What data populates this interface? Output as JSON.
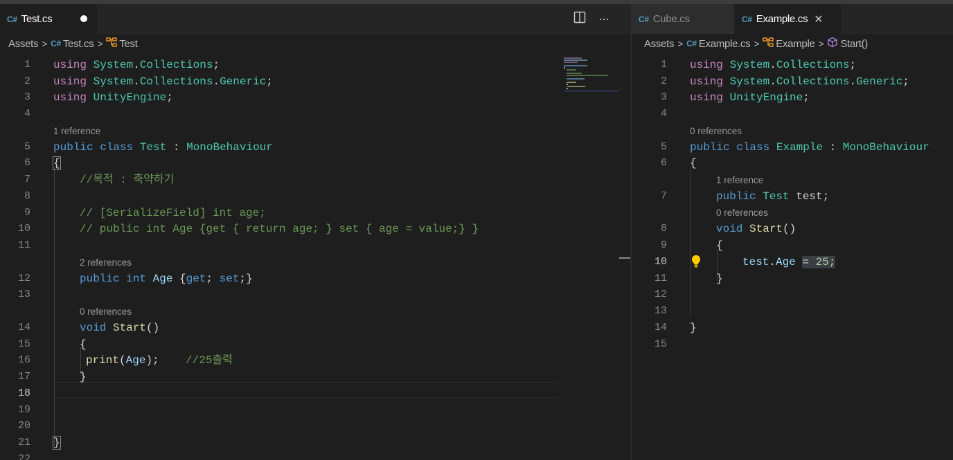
{
  "left": {
    "tabs": [
      {
        "label": "Test.cs",
        "active": true,
        "dirty": true
      }
    ],
    "actions": {
      "split_icon": "split-editor-icon",
      "more_label": "···"
    },
    "breadcrumb": {
      "folder": "Assets",
      "file": "Test.cs",
      "symbol": "Test"
    },
    "lines": [
      "1",
      "2",
      "3",
      "4",
      "5",
      "6",
      "7",
      "8",
      "9",
      "10",
      "11",
      "12",
      "13",
      "14",
      "15",
      "16",
      "17",
      "18",
      "19",
      "20",
      "21",
      "22"
    ],
    "current_line": "18",
    "lenses": {
      "class_refs": "1 reference",
      "age_refs": "2 references",
      "start_refs": "0 references"
    },
    "code": {
      "l1": {
        "kw": "using",
        "ns1": "System",
        "dot": ".",
        "ns2": "Collections",
        "end": ";"
      },
      "l2": {
        "kw": "using",
        "ns1": "System",
        "dot1": ".",
        "ns2": "Collections",
        "dot2": ".",
        "ns3": "Generic",
        "end": ";"
      },
      "l3": {
        "kw": "using",
        "ns1": "UnityEngine",
        "end": ";"
      },
      "l5": {
        "kw1": "public",
        "kw2": "class",
        "name": "Test",
        "colon": " : ",
        "base": "MonoBehaviour"
      },
      "l6": {
        "brace": "{"
      },
      "l7": {
        "comment": "//목적 : 축약하기"
      },
      "l9": {
        "comment": "// [SerializeField] int age;"
      },
      "l10": {
        "comment": "// public int Age {get { return age; } set { age = value;} }"
      },
      "l12": {
        "kw1": "public",
        "kw2": "int",
        "name": "Age",
        "open": " {",
        "get": "get",
        "semi1": "; ",
        "set": "set",
        "close": ";}"
      },
      "l14": {
        "kw": "void",
        "fn": "Start",
        "parens": "()"
      },
      "l15": {
        "brace": "{"
      },
      "l16": {
        "fn": "print",
        "open": "(",
        "arg": "Age",
        "close": ");",
        "gap": "    ",
        "comment": "//25출력"
      },
      "l17": {
        "brace": "}"
      },
      "l21": {
        "brace": "}"
      }
    }
  },
  "right": {
    "tabs": [
      {
        "label": "Cube.cs",
        "active": false
      },
      {
        "label": "Example.cs",
        "active": true,
        "close": "✕"
      }
    ],
    "breadcrumb": {
      "folder": "Assets",
      "file": "Example.cs",
      "symbol": "Example",
      "method": "Start()"
    },
    "lines": [
      "1",
      "2",
      "3",
      "4",
      "5",
      "6",
      "7",
      "8",
      "9",
      "10",
      "11",
      "12",
      "13",
      "14",
      "15"
    ],
    "current_line": "10",
    "lenses": {
      "class_refs": "0 references",
      "field_refs": "1 reference",
      "start_refs": "0 references"
    },
    "code": {
      "l1": {
        "kw": "using",
        "ns1": "System",
        "dot": ".",
        "ns2": "Collections",
        "end": ";"
      },
      "l2": {
        "kw": "using",
        "ns1": "System",
        "dot1": ".",
        "ns2": "Collections",
        "dot2": ".",
        "ns3": "Generic",
        "end": ";"
      },
      "l3": {
        "kw": "using",
        "ns1": "UnityEngine",
        "end": ";"
      },
      "l5": {
        "kw1": "public",
        "kw2": "class",
        "name": "Example",
        "colon": " : ",
        "base": "MonoBehaviour"
      },
      "l6": {
        "brace": "{"
      },
      "l7": {
        "kw": "public",
        "type": "Test",
        "rest": " test;"
      },
      "l8": {
        "kw": "void",
        "fn": "Start",
        "parens": "()"
      },
      "l9": {
        "brace": "{"
      },
      "l10": {
        "obj": "test",
        "dot": ".",
        "prop": "Age",
        "sp": " ",
        "assign": "= ",
        "num": "25",
        "end": ";"
      },
      "l11": {
        "brace": "}"
      },
      "l14": {
        "brace": "}"
      }
    }
  },
  "colors": {
    "background": "#1e1e1e",
    "keyword": "#569cd6",
    "control_keyword": "#c586c0",
    "type": "#4ec9b0",
    "function": "#dcdcaa",
    "variable": "#9cdcfe",
    "number": "#b5cea8",
    "comment": "#6a9955"
  },
  "icons": {
    "csharp_file": "csharp-file-icon",
    "class_symbol": "class-symbol-icon",
    "method_symbol": "method-cube-icon",
    "lightbulb": "lightbulb-icon"
  }
}
